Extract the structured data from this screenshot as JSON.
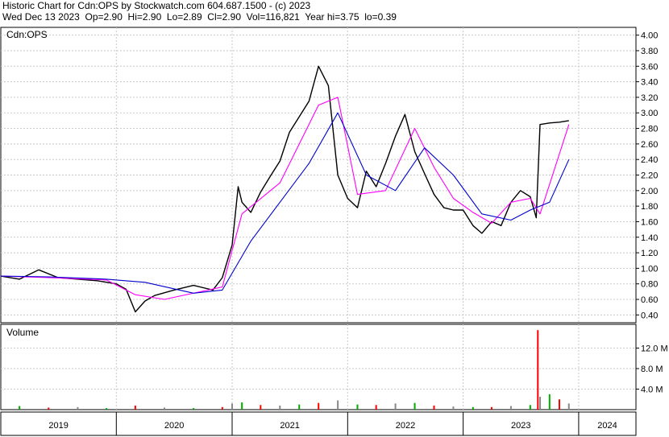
{
  "header": {
    "line1": "Historic Chart for Cdn:OPS by Stockwatch.com 604.687.1500 - (c) 2023",
    "line2": "Wed Dec 13 2023  Op=2.90  Hi=2.90  Lo=2.89  Cl=2.90  Vol=116,821  Year hi=3.75  lo=0.39"
  },
  "colors": {
    "price": "#000000",
    "ma_short": "#ff00ff",
    "ma_long": "#0000cc",
    "vol_up": "#00aa00",
    "vol_down": "#ff0000",
    "vol_neutral": "#888888",
    "grid": "#c8c8c8"
  },
  "chart_data": [
    {
      "type": "line",
      "label": "Cdn:OPS",
      "ylim": [
        0.3,
        4.1
      ],
      "y_ticks": [
        "4.00",
        "3.80",
        "3.60",
        "3.40",
        "3.20",
        "3.00",
        "2.80",
        "2.60",
        "2.40",
        "2.20",
        "2.00",
        "1.80",
        "1.60",
        "1.40",
        "1.20",
        "1.00",
        "0.80",
        "0.60",
        "0.40"
      ],
      "x_ticks": [
        "2019",
        "2020",
        "2021",
        "2022",
        "2023",
        "2024"
      ],
      "x_range": [
        "2019-01-01",
        "2024-06-30"
      ],
      "grid": true,
      "series": [
        {
          "x": [
            "2019-01",
            "2019-03",
            "2019-05",
            "2019-07",
            "2019-09",
            "2019-11",
            "2020-01",
            "2020-02",
            "2020-03",
            "2020-04",
            "2020-05",
            "2020-07",
            "2020-09",
            "2020-11",
            "2020-12",
            "2021-01",
            "2021-01-20",
            "2021-02",
            "2021-03",
            "2021-04",
            "2021-05",
            "2021-06",
            "2021-07",
            "2021-08",
            "2021-09",
            "2021-10",
            "2021-11",
            "2021-12",
            "2022-01",
            "2022-02",
            "2022-03",
            "2022-04",
            "2022-05",
            "2022-06",
            "2022-07",
            "2022-08",
            "2022-09",
            "2022-10",
            "2022-11",
            "2022-12",
            "2023-01",
            "2023-02",
            "2023-03",
            "2023-04",
            "2023-05",
            "2023-06",
            "2023-07",
            "2023-08",
            "2023-08-20",
            "2023-09",
            "2023-09-15",
            "2023-10",
            "2023-11",
            "2023-12"
          ],
          "values": [
            0.9,
            0.86,
            0.98,
            0.88,
            0.86,
            0.84,
            0.8,
            0.73,
            0.44,
            0.58,
            0.65,
            0.72,
            0.78,
            0.72,
            0.88,
            1.3,
            2.05,
            1.85,
            1.72,
            1.98,
            2.18,
            2.38,
            2.75,
            2.95,
            3.15,
            3.6,
            3.35,
            2.2,
            1.9,
            1.78,
            2.25,
            2.05,
            2.35,
            2.7,
            2.98,
            2.5,
            2.22,
            1.95,
            1.78,
            1.75,
            1.75,
            1.55,
            1.45,
            1.6,
            1.55,
            1.85,
            2.0,
            1.92,
            1.65,
            2.85,
            2.86,
            2.87,
            2.88,
            2.9
          ]
        },
        {
          "x": [
            "2019-01",
            "2019-06",
            "2019-12",
            "2020-03",
            "2020-06",
            "2020-12",
            "2021-02",
            "2021-06",
            "2021-10",
            "2021-12",
            "2022-02",
            "2022-05",
            "2022-08",
            "2022-10",
            "2022-12",
            "2023-02",
            "2023-04",
            "2023-06",
            "2023-08",
            "2023-09",
            "2023-12"
          ],
          "values": [
            0.9,
            0.88,
            0.85,
            0.66,
            0.6,
            0.76,
            1.7,
            2.1,
            3.1,
            3.2,
            1.95,
            2.0,
            2.8,
            2.3,
            1.9,
            1.72,
            1.58,
            1.85,
            1.9,
            1.7,
            2.85
          ]
        },
        {
          "x": [
            "2019-01",
            "2019-06",
            "2019-12",
            "2020-04",
            "2020-09",
            "2020-12",
            "2021-03",
            "2021-06",
            "2021-09",
            "2021-12",
            "2022-03",
            "2022-06",
            "2022-09",
            "2022-12",
            "2023-03",
            "2023-06",
            "2023-08",
            "2023-10",
            "2023-12"
          ],
          "values": [
            0.9,
            0.89,
            0.86,
            0.82,
            0.68,
            0.72,
            1.35,
            1.85,
            2.35,
            3.0,
            2.2,
            2.0,
            2.55,
            2.2,
            1.7,
            1.62,
            1.75,
            1.85,
            2.4
          ]
        }
      ]
    },
    {
      "type": "bar",
      "label": "Volume",
      "ylim": [
        0,
        16
      ],
      "y_ticks": [
        "12.0 M",
        "8.0 M",
        "4.0 M"
      ],
      "x": [
        "2019-03",
        "2019-06",
        "2019-09",
        "2019-12",
        "2020-03",
        "2020-06",
        "2020-09",
        "2020-12",
        "2021-01",
        "2021-02",
        "2021-04",
        "2021-06",
        "2021-08",
        "2021-10",
        "2021-12",
        "2022-02",
        "2022-04",
        "2022-06",
        "2022-08",
        "2022-10",
        "2022-12",
        "2023-02",
        "2023-04",
        "2023-06",
        "2023-08",
        "2023-08-25",
        "2023-09",
        "2023-10",
        "2023-11",
        "2023-12"
      ],
      "values": [
        0.7,
        0.4,
        0.5,
        0.3,
        0.8,
        0.4,
        0.3,
        0.5,
        1.2,
        1.4,
        0.9,
        0.8,
        1.0,
        1.3,
        1.8,
        1.0,
        0.9,
        1.2,
        1.3,
        0.8,
        0.6,
        0.5,
        0.5,
        0.7,
        0.9,
        15.5,
        2.5,
        3.0,
        2.0,
        1.2
      ]
    }
  ]
}
